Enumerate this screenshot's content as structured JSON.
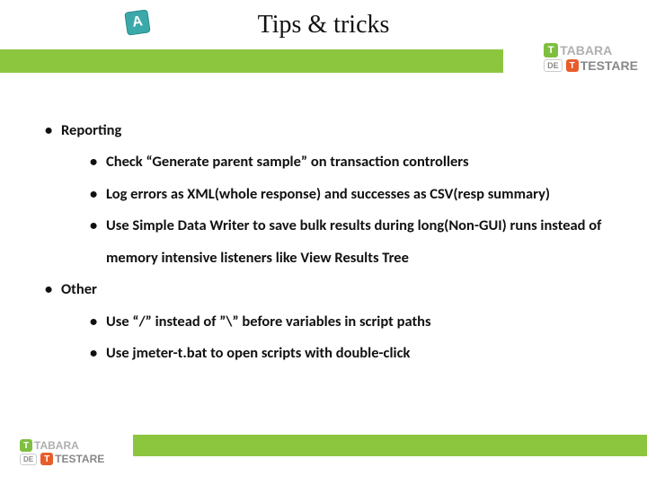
{
  "title": "Tips & tricks",
  "icon_letter": "A",
  "logo": {
    "line1": "TABARA",
    "de": "DE",
    "line2": "TESTARE"
  },
  "bullets": {
    "l1a": "Reporting",
    "l1a_1": "Check “Generate parent sample” on transaction controllers",
    "l1a_2": "Log errors as XML(whole response) and successes as CSV(resp summary)",
    "l1a_3": "Use Simple Data Writer to save bulk results during long(Non-GUI) runs instead of memory intensive listeners like View Results Tree",
    "l1b": "Other",
    "l1b_1": "Use “/” instead of ”\\” before variables in script paths",
    "l1b_2": "Use jmeter-t.bat to open scripts with double-click"
  }
}
